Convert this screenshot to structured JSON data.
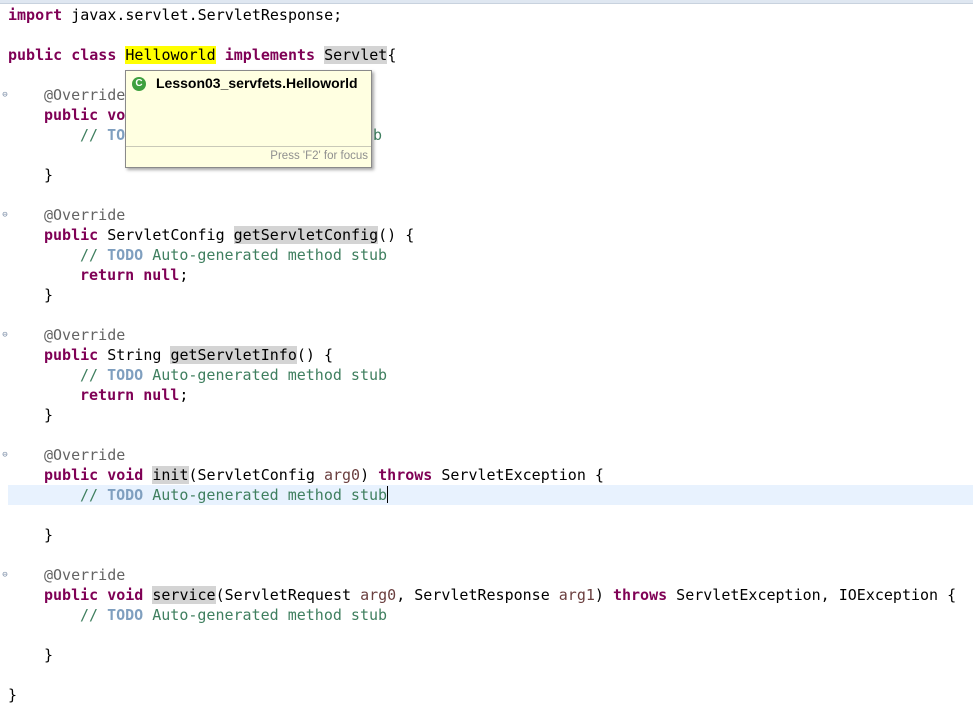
{
  "code": {
    "import_kw": "import",
    "import_path": "javax.servlet.ServletResponse;",
    "public_kw": "public",
    "class_kw": "class",
    "class_name": "Helloworld",
    "implements_kw": "implements",
    "interface_name": "Servlet",
    "open_brace": "{",
    "close_brace": "}",
    "override": "@Override",
    "todo_prefix": "// ",
    "todo_kw": "TODO",
    "todo_text": " Auto-generated method stub",
    "return_kw": "return",
    "null_kw": "null",
    "semicolon": ";",
    "m1_line1_rest": "vo",
    "m1_line2_prefix": "// ",
    "m1_line2_kw": "TO",
    "m1_line2_tail": "ub",
    "m2_type": " ServletConfig ",
    "m2_name": "getServletConfig",
    "m2_sig_tail": "() {",
    "m3_type": " String ",
    "m3_name": "getServletInfo",
    "m3_sig_tail": "() {",
    "void_kw": "void",
    "m4_name": "init",
    "m4_params_open": "(ServletConfig ",
    "arg0": "arg0",
    "params_close": ") ",
    "throws_kw": "throws",
    "m4_exceptions": " ServletException {",
    "m5_name": "service",
    "m5_params_open": "(ServletRequest ",
    "m5_params_mid": ", ServletResponse ",
    "arg1": "arg1",
    "m5_exceptions": " ServletException, IOException {"
  },
  "hover": {
    "icon": "class-icon",
    "icon_letter": "C",
    "title": "Lesson03_servfets.Helloworld",
    "hint": "Press 'F2' for focus"
  },
  "colors": {
    "keyword": "#7f0055",
    "comment": "#3f7f5f",
    "todo": "#7f9fbf",
    "annotation": "#646464",
    "current_line": "#e8f2fe",
    "search_highlight": "#ffff00",
    "occurrence": "#d4d4d4",
    "hover_bg": "#ffffe1"
  }
}
